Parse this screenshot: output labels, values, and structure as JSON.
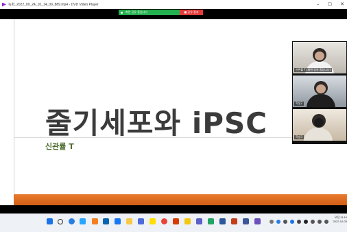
{
  "window": {
    "title": "녹화_2022_09_24_10_14_09_889.mp4 - DVD Video Player",
    "minimize": "–",
    "maximize": "▢",
    "close": "✕"
  },
  "meeting": {
    "share_text": "화면 공유 중입니다",
    "stop_share": "■ 공유 중지"
  },
  "slide": {
    "title": "줄기세포와 iPSC",
    "subtitle": "신관률 T"
  },
  "participants": [
    {
      "name": "신관률 T (화면 공유 중입니다)"
    },
    {
      "name": "학생2"
    },
    {
      "name": "학생3"
    }
  ],
  "taskbar": {
    "icons": [
      "windows-start",
      "search",
      "copilot",
      "edge",
      "vlc",
      "outlook",
      "files",
      "folder",
      "store",
      "kakao",
      "chrome",
      "office",
      "notes",
      "teams",
      "excel",
      "word",
      "powerpoint",
      "store2",
      "video-player"
    ],
    "tray": [
      "chevron-up",
      "cloud",
      "network",
      "volume",
      "keyboard",
      "record",
      "wifi",
      "speaker",
      "battery"
    ],
    "time": "오전 11:16",
    "date": "2022-10-05"
  },
  "colors": {
    "accent_orange": "#e87a2d",
    "share_green": "#23b04f",
    "stop_red": "#e33b3b",
    "subtitle_green": "#4b6b2b"
  }
}
